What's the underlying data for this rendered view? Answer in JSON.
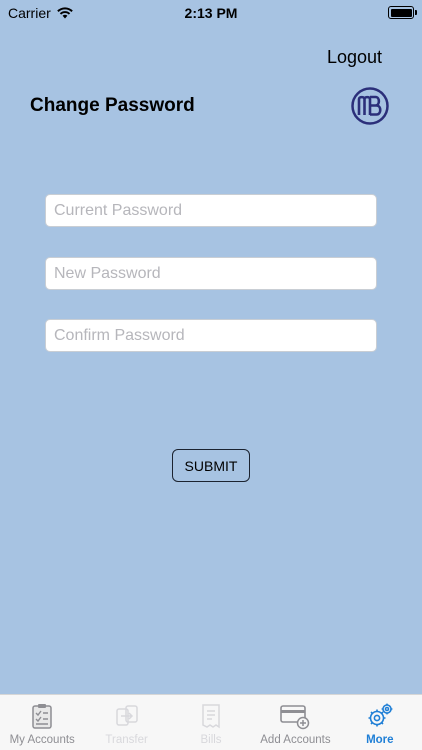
{
  "status_bar": {
    "carrier": "Carrier",
    "time": "2:13 PM"
  },
  "header": {
    "logout_label": "Logout",
    "title": "Change Password"
  },
  "form": {
    "current_placeholder": "Current Password",
    "new_placeholder": "New Password",
    "confirm_placeholder": "Confirm Password",
    "submit_label": "SUBMIT"
  },
  "tabbar": {
    "tabs": [
      {
        "label": "My Accounts",
        "icon": "clipboard-icon",
        "state": "normal"
      },
      {
        "label": "Transfer",
        "icon": "transfer-icon",
        "state": "disabled"
      },
      {
        "label": "Bills",
        "icon": "bills-icon",
        "state": "disabled"
      },
      {
        "label": "Add Accounts",
        "icon": "add-card-icon",
        "state": "normal"
      },
      {
        "label": "More",
        "icon": "gear-icon",
        "state": "active"
      }
    ]
  },
  "colors": {
    "background": "#a7c3e2",
    "accent": "#1f7fd6",
    "logo": "#2b2f7a"
  }
}
